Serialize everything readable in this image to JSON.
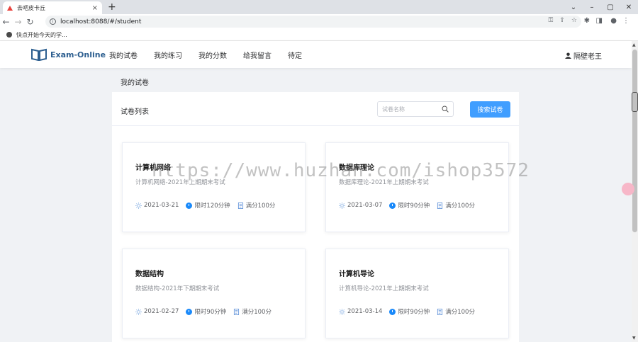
{
  "browser": {
    "tab_title": "去吧皮卡丘",
    "tab_close": "×",
    "new_tab": "+",
    "url": "localhost:8088/#/student",
    "bookmark": "快点开始今天的学..."
  },
  "header": {
    "logo_text": "Exam-Online",
    "menu": [
      "我的试卷",
      "我的练习",
      "我的分数",
      "给我留言",
      "待定"
    ],
    "user_name": "隔壁老王"
  },
  "breadcrumb": "我的试卷",
  "panel": {
    "title": "试卷列表",
    "search_placeholder": "试卷名称",
    "search_button": "搜索试卷"
  },
  "exams": [
    {
      "title": "计算机网络",
      "desc": "计算机网络-2021年上期期末考试",
      "date": "2021-03-21",
      "time": "限时120分钟",
      "score": "满分100分"
    },
    {
      "title": "数据库理论",
      "desc": "数据库理论-2021年上期期末考试",
      "date": "2021-03-07",
      "time": "限时90分钟",
      "score": "满分100分"
    },
    {
      "title": "数据结构",
      "desc": "数据结构-2021年下期期末考试",
      "date": "2021-02-27",
      "time": "限时90分钟",
      "score": "满分100分"
    },
    {
      "title": "计算机导论",
      "desc": "计算机导论-2021年上期期末考试",
      "date": "2021-03-14",
      "time": "限时90分钟",
      "score": "满分100分"
    }
  ],
  "watermark": "https://www.huzhan.com/ishop3572",
  "colors": {
    "primary": "#409eff",
    "logo": "#2c5e8f",
    "clock": "#1989fa"
  }
}
